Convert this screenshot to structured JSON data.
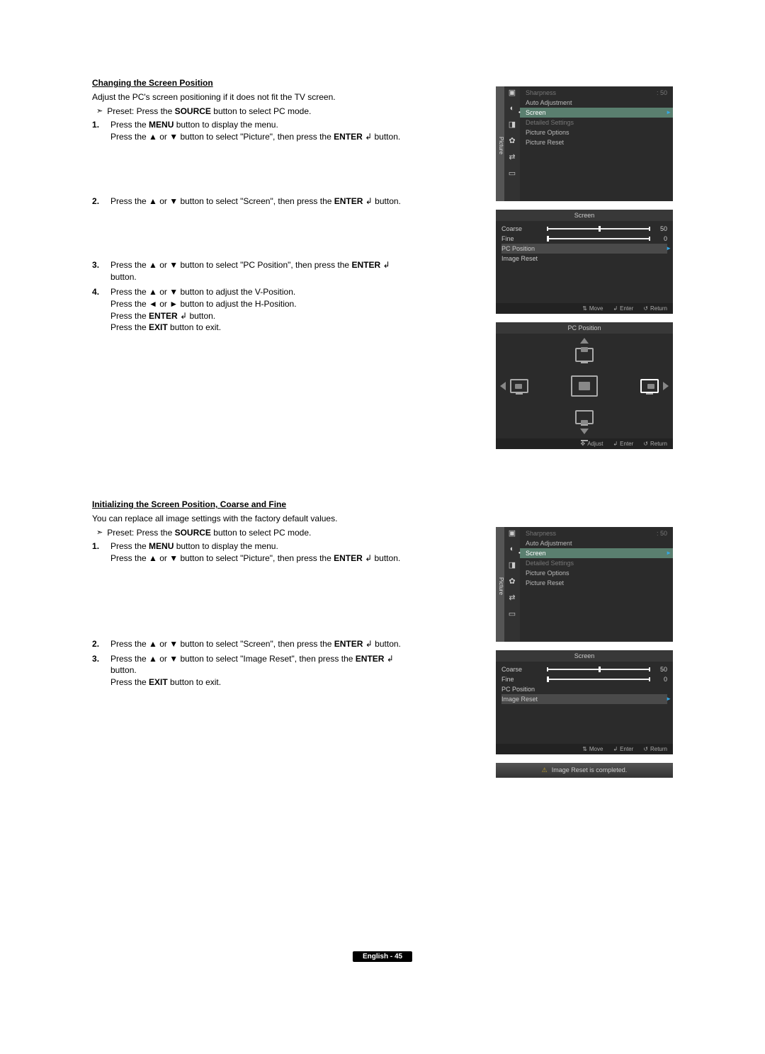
{
  "section1": {
    "title": "Changing the Screen Position",
    "intro": "Adjust the PC's screen positioning if it does not fit the TV screen.",
    "preset_prefix": "Preset: Press the ",
    "preset_bold": "SOURCE",
    "preset_suffix": " button to select PC mode.",
    "step1a": "Press the ",
    "step1a_bold": "MENU",
    "step1a_suffix": " button to display the menu.",
    "step1b": "Press the ▲ or ▼ button to select \"Picture\", then press the ",
    "step1b_bold": "ENTER",
    "step1b_icon": " ↲ ",
    "step1b_suffix": "button.",
    "step2": "Press the ▲ or ▼ button to select \"Screen\", then press the ",
    "step2_bold": "ENTER",
    "step2_suffix": "button.",
    "step3": "Press the ▲ or ▼ button to select \"PC Position\", then press the ",
    "step3_bold": "ENTER",
    "step3_suffix": "button.",
    "step4a": "Press the ▲ or ▼ button to adjust the V-Position.",
    "step4b": "Press the ◄ or ► button to adjust the H-Position.",
    "step4c_pre": "Press the ",
    "step4c_bold": "ENTER",
    "step4c_suf": " button.",
    "step4d_pre": "Press the ",
    "step4d_bold": "EXIT",
    "step4d_suf": " button to exit."
  },
  "section2": {
    "title": "Initializing the Screen Position, Coarse and Fine",
    "intro": "You can replace all image settings with the factory default values.",
    "preset_prefix": "Preset: Press the ",
    "preset_bold": "SOURCE",
    "preset_suffix": " button to select PC mode.",
    "step1a": "Press the ",
    "step1a_bold": "MENU",
    "step1a_suffix": " button to display the menu.",
    "step1b": "Press the ▲ or ▼ button to select \"Picture\", then press the ",
    "step1b_bold": "ENTER",
    "step1b_suffix": "button.",
    "step2": "Press the ▲ or ▼ button to select \"Screen\", then press the ",
    "step2_bold": "ENTER",
    "step2_suffix": "button.",
    "step3": "Press the ▲ or ▼ button to select \"Image Reset\", then press the ",
    "step3_bold": "ENTER",
    "step3_suffix": "button.",
    "step3_exit_pre": "Press the ",
    "step3_exit_bold": "EXIT",
    "step3_exit_suf": " button to exit."
  },
  "osd": {
    "picture_tab": "Picture",
    "items": {
      "sharpness": "Sharpness",
      "sharpness_val": ": 50",
      "auto_adj": "Auto Adjustment",
      "screen": "Screen",
      "detailed": "Detailed Settings",
      "options": "Picture Options",
      "reset": "Picture Reset"
    },
    "screen_title": "Screen",
    "screen": {
      "coarse": "Coarse",
      "coarse_val": "50",
      "fine": "Fine",
      "fine_val": "0",
      "pcpos": "PC Position",
      "imgreset": "Image Reset"
    },
    "hints": {
      "move": "Move",
      "adjust": "Adjust",
      "enter": "Enter",
      "return": "Return"
    },
    "pcpos_title": "PC Position",
    "toast": "Image Reset is completed."
  },
  "footer": "English - 45"
}
